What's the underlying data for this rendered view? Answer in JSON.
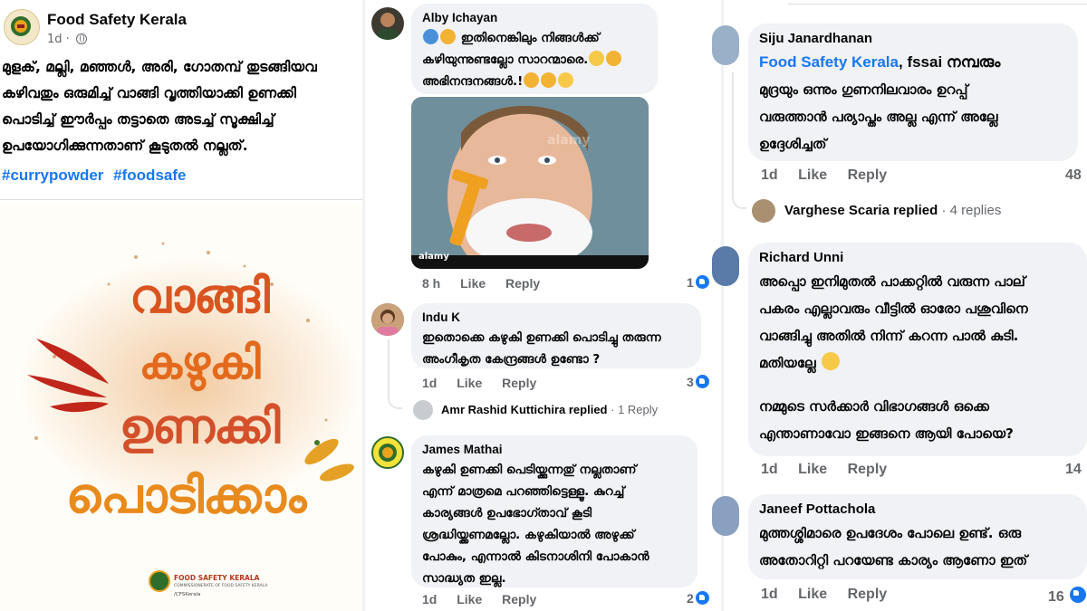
{
  "colors": {
    "fb_blue": "#1877f2",
    "bubble_bg": "#f0f2f5",
    "meta_grey": "#65676b"
  },
  "post": {
    "page_name": "Food Safety Kerala",
    "time": "1d ·",
    "body_lines": [
      "മുളക്, മല്ലി, മഞ്ഞൾ, അരി, ഗോതമ്പ് തുടങ്ങിയവ",
      "കഴിവതും ഒരുമിച്ച് വാങ്ങി വൃത്തിയാക്കി ഉണക്കി",
      "പൊടിച്ച് ഈർപ്പം തട്ടാതെ അടച്ച് സൂക്ഷിച്ച്",
      "ഉപയോഗിക്കുന്നതാണ് കൂടുതൽ നല്ലത്."
    ],
    "hashtags": [
      "#currypowder",
      "#foodsafe"
    ],
    "poster": {
      "line1": "വാങ്ങി",
      "line2": "കഴുകി",
      "line3": "ഉണക്കി",
      "line4": "പൊടിക്കാം",
      "logo_title": "FOOD SAFETY KERALA",
      "logo_sub": "COMMISSIONERATE OF FOOD SAFETY KERALA",
      "logo_social": "/CFSKerala"
    }
  },
  "comments_mid": [
    {
      "name": "Alby Ichayan",
      "text_lines": [
        "ഇതിനെങ്കിലും നിങ്ങൾക്ക്",
        "കഴിയുന്നുണ്ടല്ലോ സാറന്മാരെ.",
        "അഭിനന്ദനങ്ങൾ.!"
      ],
      "time": "8 h",
      "like": "Like",
      "reply": "Reply",
      "count": "1"
    },
    {
      "name": "Indu K",
      "text_lines": [
        "ഇതൊക്കെ കഴുകി ഉണക്കി പൊടിച്ചു തരുന്ന",
        "അംഗീകൃത കേന്ദ്രങ്ങൾ ഉണ്ടോ ?"
      ],
      "time": "1d",
      "like": "Like",
      "reply": "Reply",
      "count": "3"
    },
    {
      "name": "James Mathai",
      "text_lines": [
        "കഴുകി ഉണക്കി പെടിയ്ക്കുന്നതു് നല്ലതാണ്",
        "എന്ന് മാത്രമെ പറഞ്ഞിട്ടെള്ളൂ. കുറച്ച്",
        "കാര്യങ്ങൾ ഉപഭോഗ്താവ് കൂടി",
        "ശ്രദ്ധിയ്ക്കണമല്ലോ. കഴുകിയാൽ അഴുക്ക്",
        "പോകും, എന്നാൽ കിടനാശിനി പോകാൻ",
        "സാദ്ധ്യത ഇല്ല."
      ],
      "time": "1d",
      "like": "Like",
      "reply": "Reply",
      "count": "2"
    }
  ],
  "meme": {
    "watermark": "alamy",
    "tag": "alamy"
  },
  "reply_summary_mid": {
    "name": "Amr Rashid Kuttichira",
    "replied": "replied",
    "count": "· 1 Reply"
  },
  "comments_right": [
    {
      "name": "Siju Janardhanan",
      "mention": "Food Safety Kerala",
      "text_first_rest": ", fssai നമ്പരും",
      "text_lines": [
        "മുദ്രയും ഒന്നും ഗുണനിലവാരം ഉറപ്പ്",
        "വരുത്താൻ പര്യാപ്തം അല്ല എന്ന് അല്ലേ",
        "ഉദ്ദേശിച്ചത്"
      ],
      "time": "1d",
      "like": "Like",
      "reply": "Reply",
      "count": "48"
    },
    {
      "name": "Richard Unni",
      "text_lines": [
        "അപ്പൊ ഇനിമുതൽ പാക്കറ്റിൽ വരുന്ന പാല്",
        "പകരം എല്ലാവരും വീട്ടിൽ ഓരോ പശുവിനെ",
        "വാങ്ങിച്ചു അതിൽ നിന്ന് കറന്ന പാൽ കുടി.",
        "മതിയല്ലേ"
      ],
      "text_lines2": [
        "നമ്മുടെ സർക്കാർ വിഭാഗങ്ങൾ ഒക്കെ",
        "എന്താണാവോ ഇങ്ങനെ ആയി പോയെ?"
      ],
      "time": "1d",
      "like": "Like",
      "reply": "Reply",
      "count": "14"
    },
    {
      "name": "Janeef Pottachola",
      "text_lines": [
        "മുത്തശ്ശിമാരെ ഉപദേശം പോലെ ഉണ്ട്. ഒരു",
        "അതോറിറ്റി പറയേണ്ട കാര്യം ആണോ ഇത്"
      ],
      "time": "1d",
      "like": "Like",
      "reply": "Reply",
      "count": "16"
    }
  ],
  "reply_summary_right": {
    "name": "Varghese Scaria",
    "replied": "replied",
    "count": "· 4 replies"
  }
}
